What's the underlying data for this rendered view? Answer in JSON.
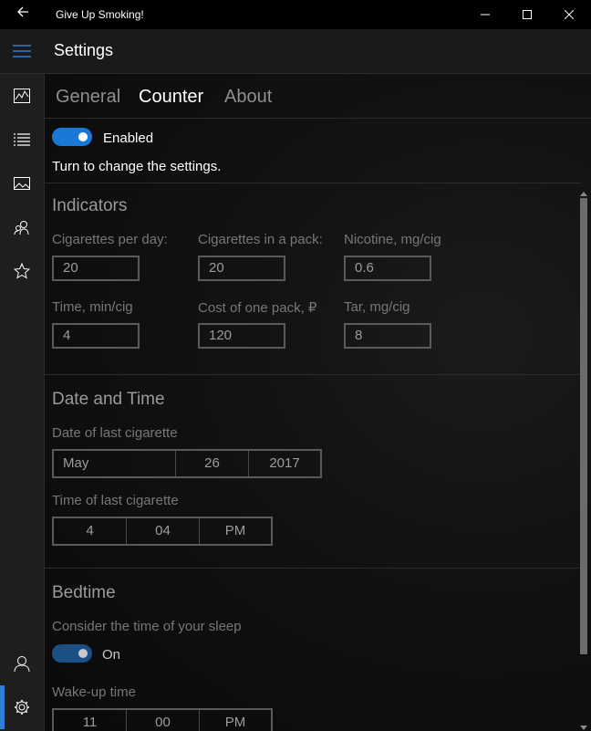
{
  "window": {
    "title": "Give Up Smoking!"
  },
  "appbar": {
    "title": "Settings"
  },
  "tabs": [
    {
      "label": "General"
    },
    {
      "label": "Counter"
    },
    {
      "label": "About"
    }
  ],
  "enabled_toggle": {
    "label": "Enabled",
    "hint": "Turn to change the settings."
  },
  "indicators": {
    "title": "Indicators",
    "fields": [
      {
        "label": "Cigarettes per day:",
        "value": "20"
      },
      {
        "label": "Cigarettes in a pack:",
        "value": "20"
      },
      {
        "label": "Nicotine, mg/cig",
        "value": "0.6"
      },
      {
        "label": "Time, min/cig",
        "value": "4"
      },
      {
        "label": "Cost of one pack, ₽",
        "value": "120"
      },
      {
        "label": "Tar, mg/cig",
        "value": "8"
      }
    ]
  },
  "datetime": {
    "title": "Date and Time",
    "date_label": "Date of last cigarette",
    "date": {
      "month": "May",
      "day": "26",
      "year": "2017"
    },
    "time_label": "Time of last cigarette",
    "time": {
      "hour": "4",
      "minute": "04",
      "period": "PM"
    }
  },
  "bedtime": {
    "title": "Bedtime",
    "consider_label": "Consider the time of your sleep",
    "toggle_label": "On",
    "wake_label": "Wake-up time",
    "wake_time": {
      "hour": "11",
      "minute": "00",
      "period": "PM"
    }
  },
  "colors": {
    "accent": "#1a78d6",
    "background": "#0f0f0f",
    "sidebar": "#1e1e1e"
  },
  "icons": {
    "sidebar": [
      "chart-icon",
      "list-icon",
      "image-icon",
      "people-icon",
      "star-icon",
      "user-icon",
      "settings-icon"
    ]
  }
}
